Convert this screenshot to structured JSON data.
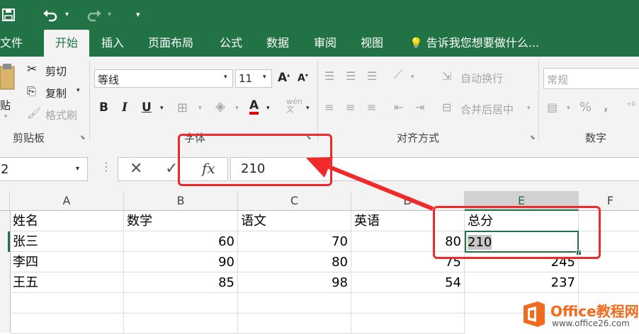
{
  "qat": {
    "save_icon": "save-icon",
    "undo_icon": "undo-icon",
    "redo_icon": "redo-icon",
    "customize_icon": "customize-qat-icon"
  },
  "tabs": [
    "文件",
    "开始",
    "插入",
    "页面布局",
    "公式",
    "数据",
    "审阅",
    "视图"
  ],
  "tell_me": "告诉我您想要做什么...",
  "ribbon": {
    "clipboard": {
      "paste_partial": "贴",
      "cut": "剪切",
      "copy": "复制",
      "format_painter": "格式刷",
      "group_label": "剪贴板"
    },
    "font": {
      "font_name": "等线",
      "font_size": "11",
      "group_label": "字体"
    },
    "alignment": {
      "wrap_text": "自动换行",
      "merge_center": "合并后居中",
      "group_label": "对齐方式"
    },
    "number": {
      "format": "常规",
      "group_label": "数字"
    }
  },
  "formula_bar": {
    "name_box": "2",
    "fx": "fx",
    "value": "210"
  },
  "sheet": {
    "columns": [
      "A",
      "B",
      "C",
      "D",
      "E",
      "F"
    ],
    "selected_column": "E",
    "rows": [
      [
        "姓名",
        "数学",
        "语文",
        "英语",
        "总分"
      ],
      [
        "张三",
        "60",
        "70",
        "80",
        "210"
      ],
      [
        "李四",
        "90",
        "80",
        "75",
        "245"
      ],
      [
        "王五",
        "85",
        "98",
        "54",
        "237"
      ]
    ],
    "active_cell": "E2"
  },
  "watermark": {
    "brand": "Office教程网",
    "url": "www.office26.com"
  },
  "colors": {
    "excel_green": "#217346",
    "annotation_red": "#f02a2a",
    "watermark_orange": "#f26a1b"
  }
}
